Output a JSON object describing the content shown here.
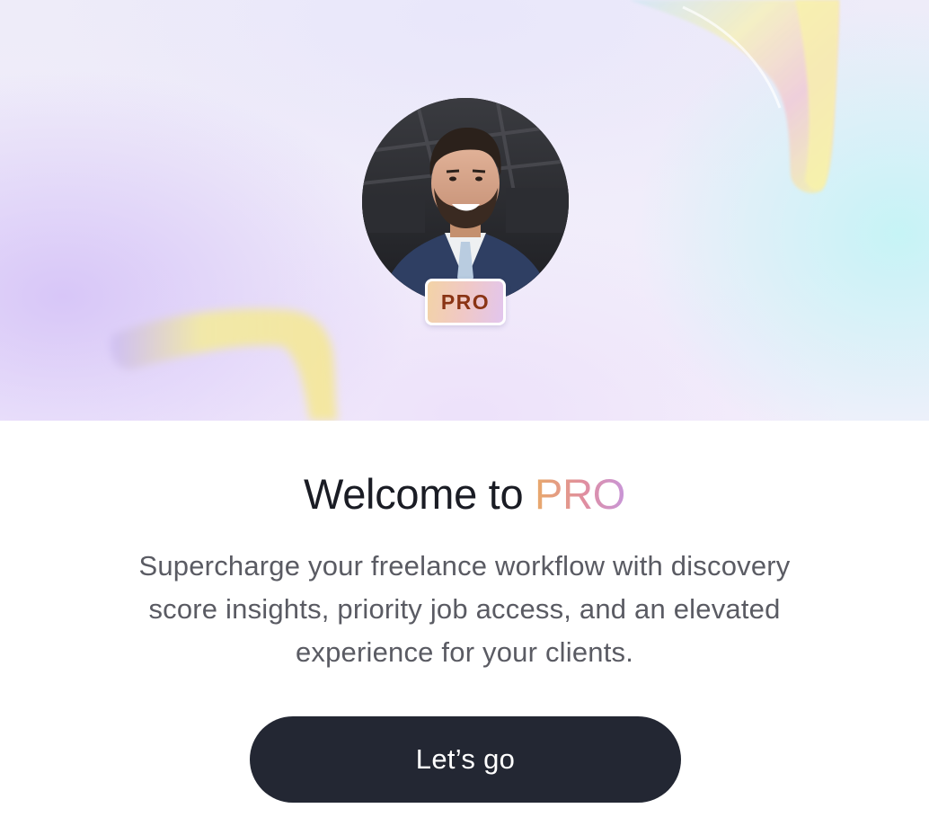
{
  "hero": {
    "badge_label": "PRO",
    "avatar_alt": "profile photo"
  },
  "welcome": {
    "title_prefix": "Welcome to",
    "title_accent": "PRO",
    "description": "Supercharge your freelance workflow with discovery score insights, priority job access, and an elevated experience for your clients."
  },
  "cta": {
    "label": "Let’s go"
  },
  "colors": {
    "button_bg": "#232733",
    "badge_text": "#8a3414",
    "accent_gradient_start": "#e8a96a",
    "accent_gradient_end": "#c896d8",
    "title_text": "#1a1c24",
    "body_text": "#5a5b63"
  }
}
